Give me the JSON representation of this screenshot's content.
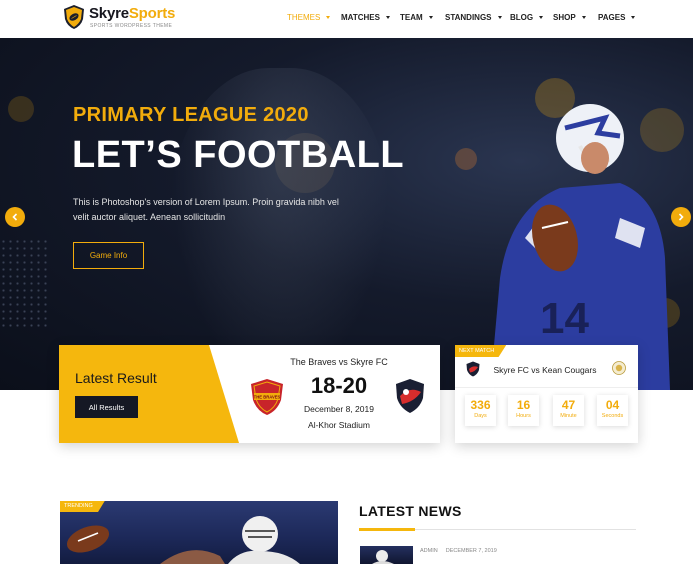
{
  "brand": {
    "name_part1": "Skyre",
    "name_part2": "Sports",
    "tagline": "SPORTS WORDPRESS THEME",
    "accent": "#f2ac0c",
    "dark": "#151824"
  },
  "nav": {
    "items": [
      {
        "label": "THEMES"
      },
      {
        "label": "MATCHES"
      },
      {
        "label": "TEAM"
      },
      {
        "label": "STANDINGS"
      },
      {
        "label": "BLOG"
      },
      {
        "label": "SHOP"
      },
      {
        "label": "PAGES"
      }
    ]
  },
  "hero": {
    "kicker": "PRIMARY LEAGUE 2020",
    "headline": "LET’S FOOTBALL",
    "blurb": "This is Photoshop's version of Lorem Ipsum. Proin gravida nibh vel velit auctor aliquet. Aenean sollicitudin",
    "button": "Game Info",
    "prev_icon": "chevron-left-icon",
    "next_icon": "chevron-right-icon"
  },
  "latest_result": {
    "label": "Latest Result",
    "button": "All Results",
    "match": "The Braves vs Skyre FC",
    "score": "18-20",
    "date": "December 8, 2019",
    "venue": "Al-Khor Stadium",
    "home_crest_text": "THE BRAVES"
  },
  "next_match": {
    "tag": "NEXT MATCH",
    "title": "Skyre FC vs Kean Cougars",
    "countdown": [
      {
        "value": "336",
        "unit": "Days"
      },
      {
        "value": "16",
        "unit": "Hours"
      },
      {
        "value": "47",
        "unit": "Minute"
      },
      {
        "value": "04",
        "unit": "Seconds"
      }
    ]
  },
  "trending": {
    "tag": "TRENDING"
  },
  "news": {
    "heading": "LATEST NEWS",
    "items": [
      {
        "author": "ADMIN",
        "date": "DECEMBER 7, 2019"
      }
    ]
  }
}
